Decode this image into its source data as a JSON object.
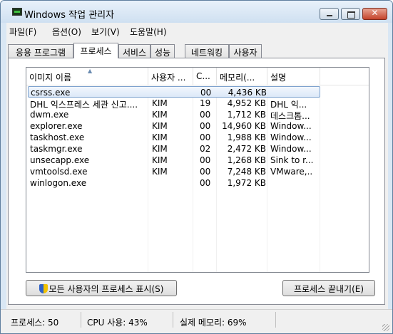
{
  "window": {
    "title": "Windows 작업 관리자",
    "close_label": "✕"
  },
  "menu": [
    "파일(F)",
    "옵션(O)",
    "보기(V)",
    "도움말(H)"
  ],
  "tabs": [
    "응용 프로그램",
    "프로세스",
    "서비스",
    "성능",
    "네트워킹",
    "사용자"
  ],
  "active_tab": "프로세스",
  "columns": {
    "name": "이미지 이름",
    "user": "사용자 ...",
    "cpu": "C...",
    "mem": "메모리(...",
    "desc": "설명"
  },
  "processes": [
    {
      "name": "csrss.exe",
      "user": "",
      "cpu": "00",
      "mem": "4,436 KB",
      "desc": ""
    },
    {
      "name": "DHL 익스프레스 세관 신고....",
      "user": "KIM",
      "cpu": "19",
      "mem": "4,952 KB",
      "desc": "DHL 익..."
    },
    {
      "name": "dwm.exe",
      "user": "KIM",
      "cpu": "00",
      "mem": "1,712 KB",
      "desc": "데스크톱..."
    },
    {
      "name": "explorer.exe",
      "user": "KIM",
      "cpu": "00",
      "mem": "14,960 KB",
      "desc": "Window..."
    },
    {
      "name": "taskhost.exe",
      "user": "KIM",
      "cpu": "00",
      "mem": "1,988 KB",
      "desc": "Window..."
    },
    {
      "name": "taskmgr.exe",
      "user": "KIM",
      "cpu": "02",
      "mem": "2,472 KB",
      "desc": "Window..."
    },
    {
      "name": "unsecapp.exe",
      "user": "KIM",
      "cpu": "00",
      "mem": "1,268 KB",
      "desc": "Sink to r..."
    },
    {
      "name": "vmtoolsd.exe",
      "user": "KIM",
      "cpu": "00",
      "mem": "7,248 KB",
      "desc": "VMware,..."
    },
    {
      "name": "winlogon.exe",
      "user": "",
      "cpu": "00",
      "mem": "1,972 KB",
      "desc": ""
    }
  ],
  "buttons": {
    "show_all": "모든 사용자의 프로세스 표시(S)",
    "end_process": "프로세스 끝내기(E)"
  },
  "status": {
    "processes": "프로세스: 50",
    "cpu": "CPU 사용: 43%",
    "memory": "실제 메모리: 69%"
  }
}
